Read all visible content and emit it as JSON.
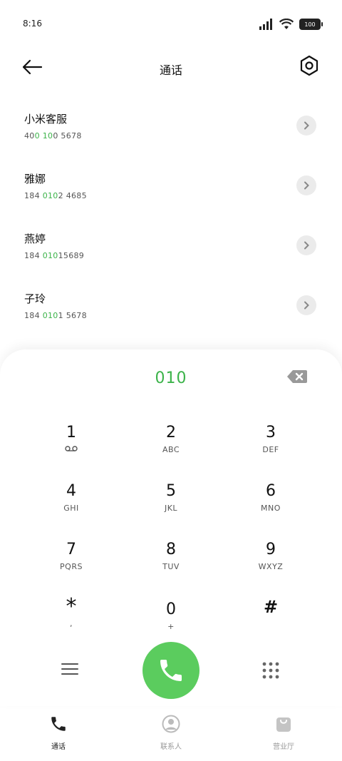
{
  "status": {
    "time": "8:16",
    "battery": "100"
  },
  "header": {
    "title": "通话"
  },
  "contacts": [
    {
      "name": "小米客服",
      "number_parts": [
        "40",
        "0",
        " ",
        "10",
        "0",
        "  5678"
      ]
    },
    {
      "name": "雅娜",
      "number_parts": [
        "184  ",
        "010",
        "2  4685",
        "",
        "",
        ""
      ]
    },
    {
      "name": "燕婷",
      "number_parts": [
        "184  ",
        "010",
        "15689",
        "",
        "",
        ""
      ]
    },
    {
      "name": "子玲",
      "number_parts": [
        "184  ",
        "010",
        "1  5678",
        "",
        "",
        ""
      ]
    }
  ],
  "dialer": {
    "number": "010"
  },
  "keypad": [
    {
      "digit": "1",
      "letters": ""
    },
    {
      "digit": "2",
      "letters": "ABC"
    },
    {
      "digit": "3",
      "letters": "DEF"
    },
    {
      "digit": "4",
      "letters": "GHI"
    },
    {
      "digit": "5",
      "letters": "JKL"
    },
    {
      "digit": "6",
      "letters": "MNO"
    },
    {
      "digit": "7",
      "letters": "PQRS"
    },
    {
      "digit": "8",
      "letters": "TUV"
    },
    {
      "digit": "9",
      "letters": "WXYZ"
    },
    {
      "digit": "*",
      "letters": ","
    },
    {
      "digit": "0",
      "letters": "+"
    },
    {
      "digit": "#",
      "letters": ""
    }
  ],
  "nav": {
    "calls": "通话",
    "contacts": "联系人",
    "store": "营业厅"
  },
  "colors": {
    "accent": "#3cb34a",
    "call_button": "#5bcc5e"
  }
}
